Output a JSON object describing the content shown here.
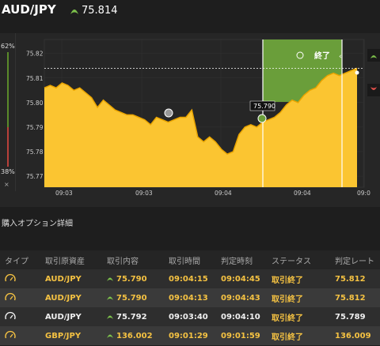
{
  "header": {
    "pair": "AUD/JPY",
    "price": "75.814",
    "accent": "#7cc04b"
  },
  "left_panel": {
    "top_pct": "62%",
    "bottom_pct": "38%",
    "close": "×"
  },
  "chart_data": {
    "type": "area",
    "y_ticks": [
      "75.82",
      "75.81",
      "75.80",
      "75.79",
      "75.78",
      "75.77"
    ],
    "ylim": [
      75.7655,
      75.8257
    ],
    "x_ticks": [
      "09:03",
      "09:03",
      "09:04",
      "09:04",
      "09:0"
    ],
    "series": [
      {
        "values": [
          75.806,
          75.807,
          75.806,
          75.808,
          75.807,
          75.805,
          75.806,
          75.804,
          75.802,
          75.798,
          75.801,
          75.799,
          75.797,
          75.796,
          75.795,
          75.795,
          75.794,
          75.793,
          75.791,
          75.794,
          75.793,
          75.792,
          75.793,
          75.794,
          75.794,
          75.797,
          75.786,
          75.784,
          75.786,
          75.784,
          75.781,
          75.779,
          75.78,
          75.787,
          75.79,
          75.791,
          75.79,
          75.792,
          75.793,
          75.794,
          75.796,
          75.799,
          75.801,
          75.8,
          75.803,
          75.805,
          75.806,
          75.809,
          75.811,
          75.812,
          75.811,
          75.812,
          75.813,
          75.814
        ]
      }
    ],
    "entry_label": "75.790",
    "end_label": "終了",
    "colors": {
      "area": "#fbc531",
      "line": "#e9a400",
      "zone": "#6a9e3a"
    }
  },
  "section_title": "購入オプション詳細",
  "table": {
    "columns": [
      "タイプ",
      "取引原資産",
      "取引内容",
      "取引時間",
      "判定時刻",
      "ステータス",
      "判定レート"
    ],
    "rows": [
      {
        "asset": "AUD/JPY",
        "content": "75.790",
        "time": "09:04:15",
        "judge": "09:04:45",
        "status": "取引終了",
        "rate": "75.812"
      },
      {
        "asset": "AUD/JPY",
        "content": "75.790",
        "time": "09:04:13",
        "judge": "09:04:43",
        "status": "取引終了",
        "rate": "75.812"
      },
      {
        "asset": "AUD/JPY",
        "content": "75.792",
        "time": "09:03:40",
        "judge": "09:04:10",
        "status": "取引終了",
        "rate": "75.789"
      },
      {
        "asset": "GBP/JPY",
        "content": "136.002",
        "time": "09:01:29",
        "judge": "09:01:59",
        "status": "取引終了",
        "rate": "136.009"
      }
    ]
  }
}
